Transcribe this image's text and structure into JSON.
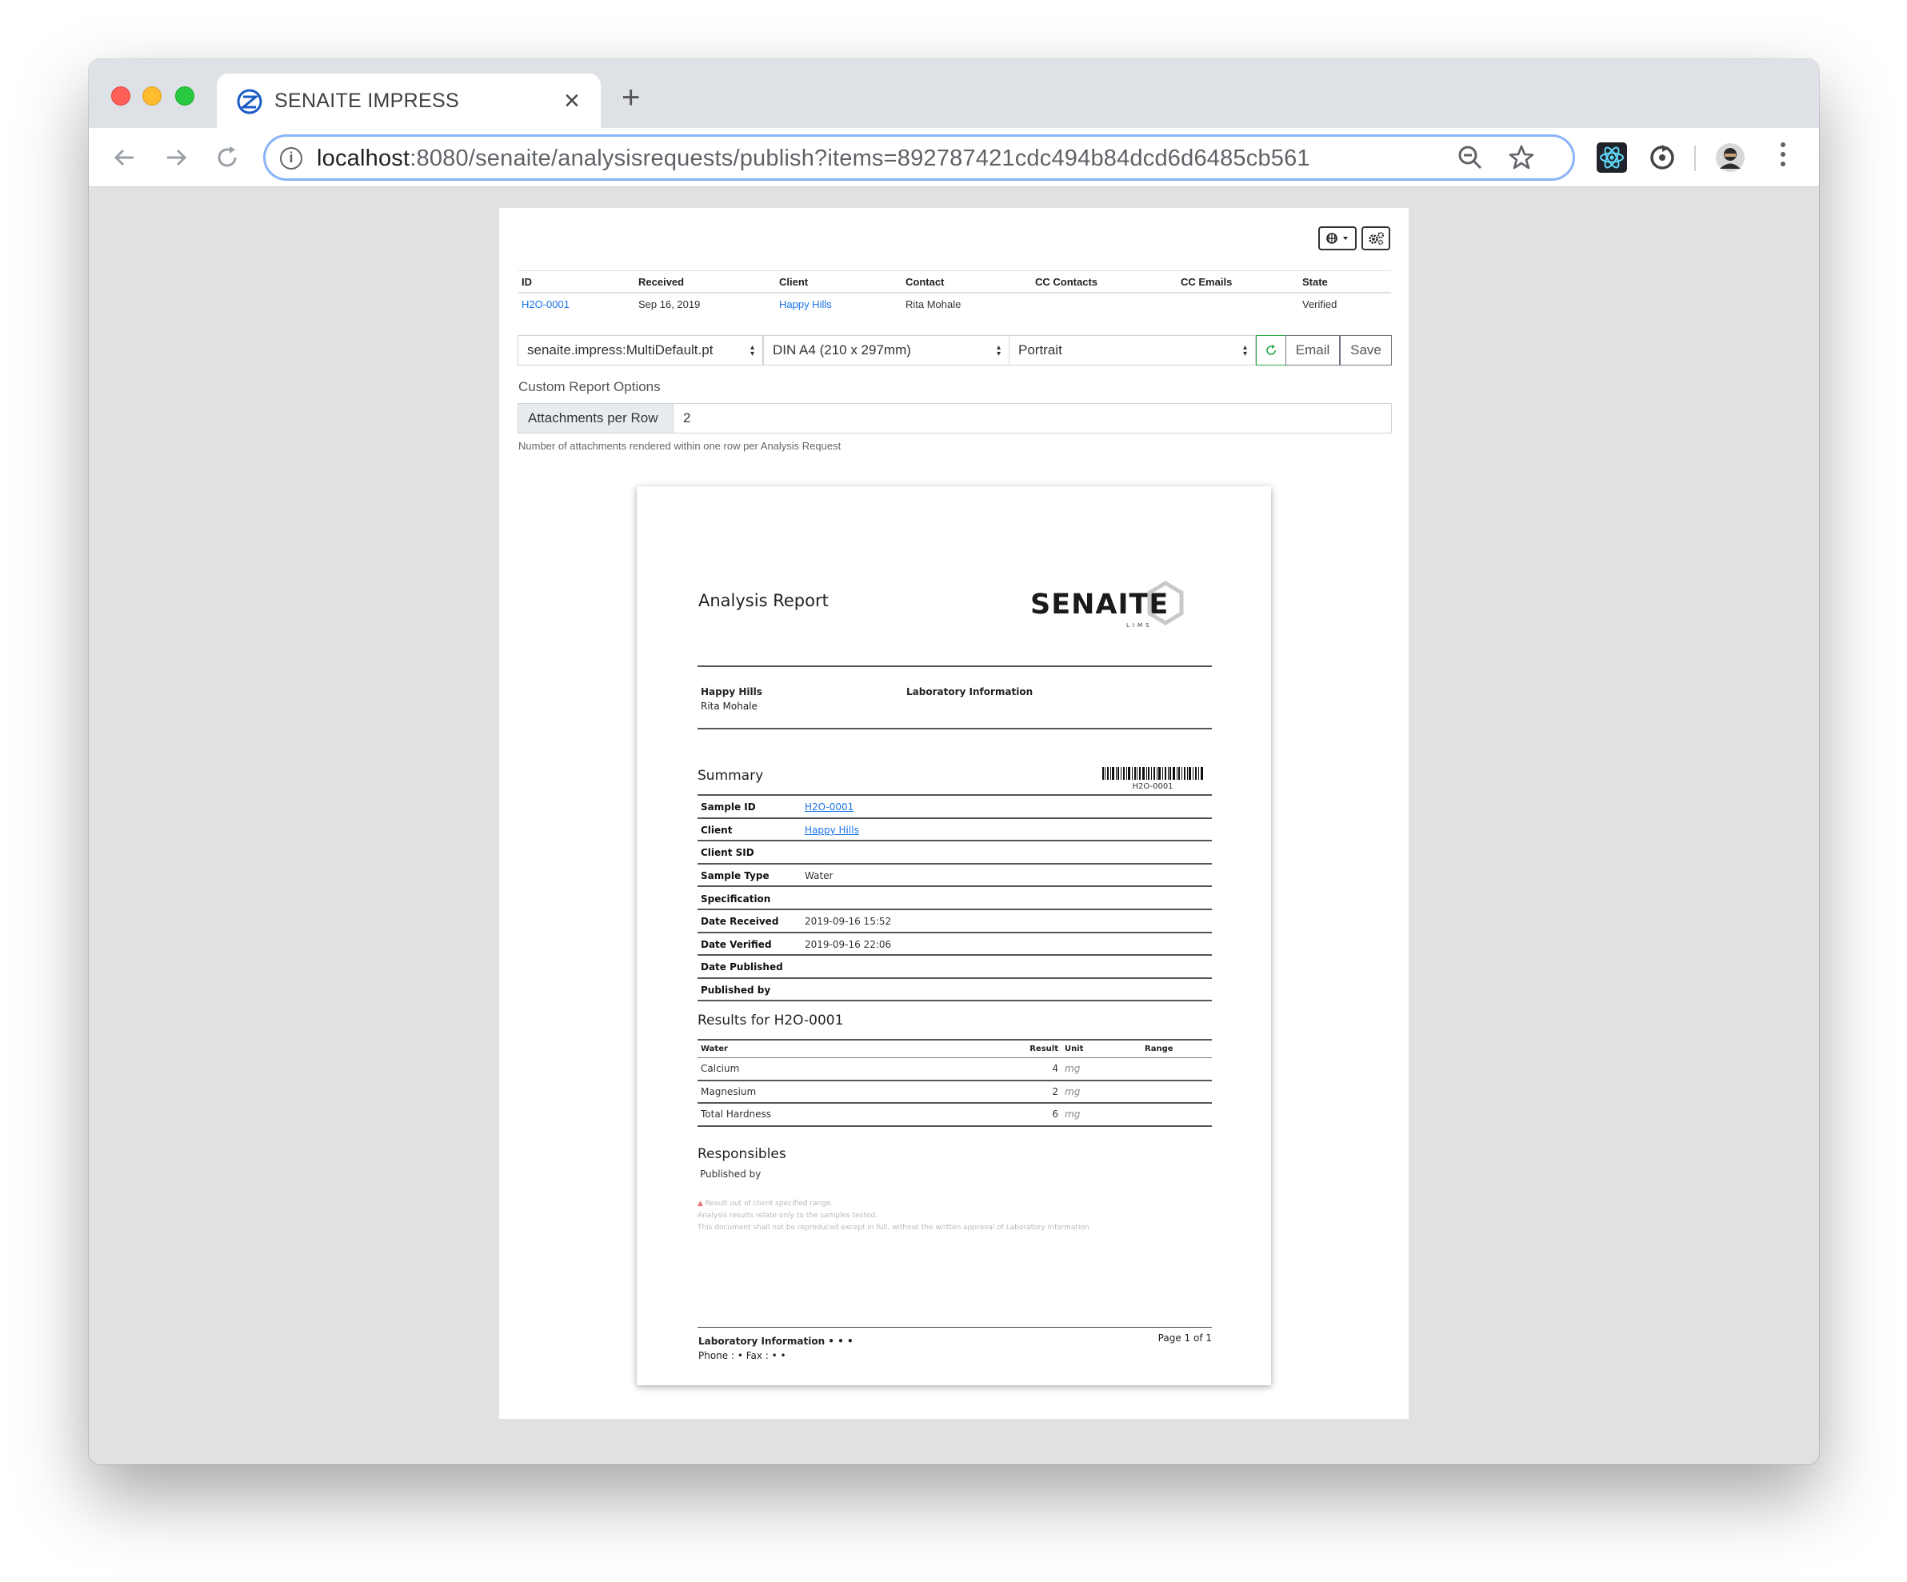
{
  "browser": {
    "tab_title": "SENAITE IMPRESS",
    "url_host": "localhost",
    "url_path": ":8080/senaite/analysisrequests/publish?items=892787421cdc494b84dcd6d6485cb561",
    "icons": [
      "back-arrow-icon",
      "forward-arrow-icon",
      "reload-icon",
      "info-icon",
      "zoom-out-icon",
      "star-icon",
      "react-devtools-icon",
      "sync-extension-icon",
      "profile-avatar",
      "kebab-menu-icon"
    ]
  },
  "meta_table": {
    "headers": [
      "ID",
      "Received",
      "Client",
      "Contact",
      "CC Contacts",
      "CC Emails",
      "State"
    ],
    "row": {
      "id": "H2O-0001",
      "received": "Sep 16, 2019",
      "client": "Happy Hills",
      "contact": "Rita Mohale",
      "cc_contacts": "",
      "cc_emails": "",
      "state": "Verified"
    }
  },
  "controls": {
    "template": "senaite.impress:MultiDefault.pt",
    "paper": "DIN A4 (210 x 297mm)",
    "orientation": "Portrait",
    "email_label": "Email",
    "save_label": "Save"
  },
  "custom_options": {
    "title": "Custom Report Options",
    "attachments_label": "Attachments per Row",
    "attachments_value": "2",
    "helper": "Number of attachments rendered within one row per Analysis Request"
  },
  "report": {
    "title": "Analysis Report",
    "logo_text": "SENAITE",
    "logo_sub": "LIMS",
    "client_name": "Happy Hills",
    "client_contact": "Rita Mohale",
    "lab_info": "Laboratory Information",
    "summary_title": "Summary",
    "barcode_label": "H2O-0001",
    "summary": [
      {
        "key": "Sample ID",
        "value": "H2O-0001"
      },
      {
        "key": "Client",
        "value": "Happy Hills"
      },
      {
        "key": "Client SID",
        "value": ""
      },
      {
        "key": "Sample Type",
        "value": "Water"
      },
      {
        "key": "Specification",
        "value": ""
      },
      {
        "key": "Date Received",
        "value": "2019-09-16 15:52"
      },
      {
        "key": "Date Verified",
        "value": "2019-09-16 22:06"
      },
      {
        "key": "Date Published",
        "value": ""
      },
      {
        "key": "Published by",
        "value": ""
      }
    ],
    "results_title": "Results for H2O-0001",
    "results_headers": {
      "category": "Water",
      "result": "Result",
      "unit": "Unit",
      "range": "Range"
    },
    "results": [
      {
        "name": "Calcium",
        "result": "4",
        "unit": "mg",
        "range": ""
      },
      {
        "name": "Magnesium",
        "result": "2",
        "unit": "mg",
        "range": ""
      },
      {
        "name": "Total Hardness",
        "result": "6",
        "unit": "mg",
        "range": ""
      }
    ],
    "responsibles_title": "Responsibles",
    "published_by": "Published by",
    "footnotes": {
      "out_of_range": "Result out of client specified range.",
      "relate": "Analysis results relate only to the samples tested.",
      "reproduce": "This document shall not be reproduced except in full, without the written approval of Laboratory Information"
    },
    "footer_lab": "Laboratory Information • • •",
    "footer_phone": "Phone : • Fax : • •",
    "page": "Page 1 of 1"
  }
}
